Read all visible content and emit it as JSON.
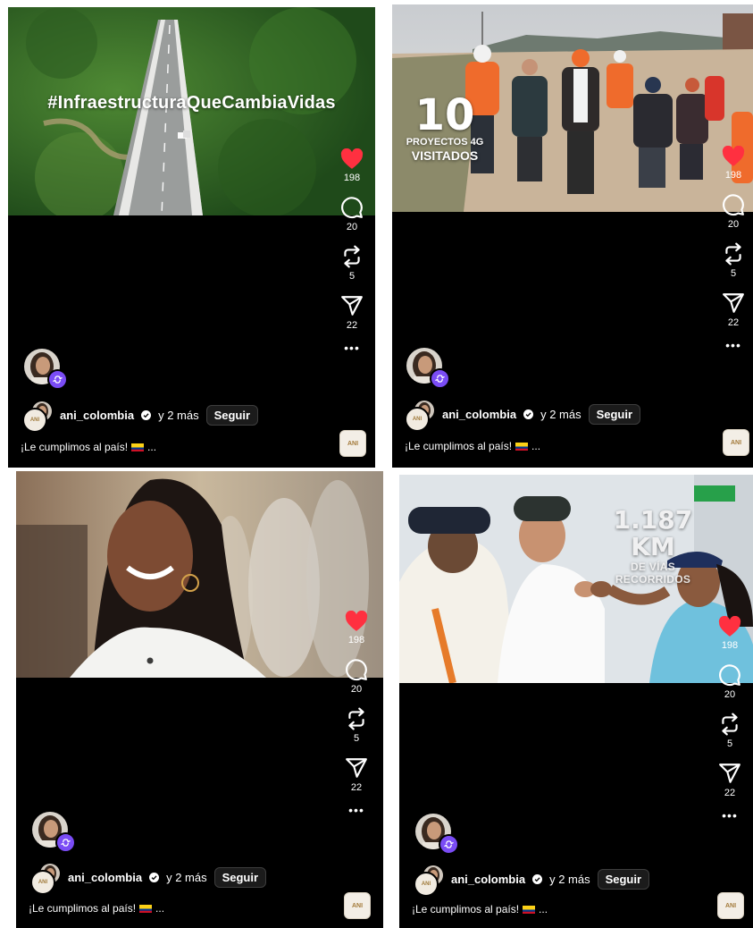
{
  "panels": [
    {
      "overlay": {
        "hashtag": "#InfraestructuraQueCambiaVidas"
      },
      "counts": {
        "likes": "198",
        "comments": "20",
        "reposts": "5",
        "shares": "22"
      },
      "user": {
        "name": "ani_colombia",
        "others": "y 2 más",
        "follow_label": "Seguir"
      },
      "caption": "¡Le cumplimos al país!",
      "caption_more": "...",
      "logo_text": "ANI"
    },
    {
      "overlay": {
        "number": "10",
        "line1": "PROYECTOS 4G",
        "line2": "VISITADOS"
      },
      "counts": {
        "likes": "198",
        "comments": "20",
        "reposts": "5",
        "shares": "22"
      },
      "user": {
        "name": "ani_colombia",
        "others": "y 2 más",
        "follow_label": "Seguir"
      },
      "caption": "¡Le cumplimos al país!",
      "caption_more": "...",
      "logo_text": "ANI"
    },
    {
      "overlay": {},
      "counts": {
        "likes": "198",
        "comments": "20",
        "reposts": "5",
        "shares": "22"
      },
      "user": {
        "name": "ani_colombia",
        "others": "y 2 más",
        "follow_label": "Seguir"
      },
      "caption": "¡Le cumplimos al país!",
      "caption_more": "...",
      "logo_text": "ANI"
    },
    {
      "overlay": {
        "km": "1.187 KM",
        "km_sub": "DE VÍAS RECORRIDOS"
      },
      "counts": {
        "likes": "198",
        "comments": "20",
        "reposts": "5",
        "shares": "22"
      },
      "user": {
        "name": "ani_colombia",
        "others": "y 2 más",
        "follow_label": "Seguir"
      },
      "caption": "¡Le cumplimos al país!",
      "caption_more": "...",
      "logo_text": "ANI"
    }
  ],
  "icons": {
    "like": "heart-icon",
    "comment": "comment-icon",
    "repost": "repost-icon",
    "share": "send-icon",
    "more": "more-icon",
    "verified": "verified-icon",
    "remix": "remix-icon"
  },
  "colors": {
    "like": "#ff3040",
    "remix_badge": "#7a4cf5",
    "background": "#000000"
  }
}
